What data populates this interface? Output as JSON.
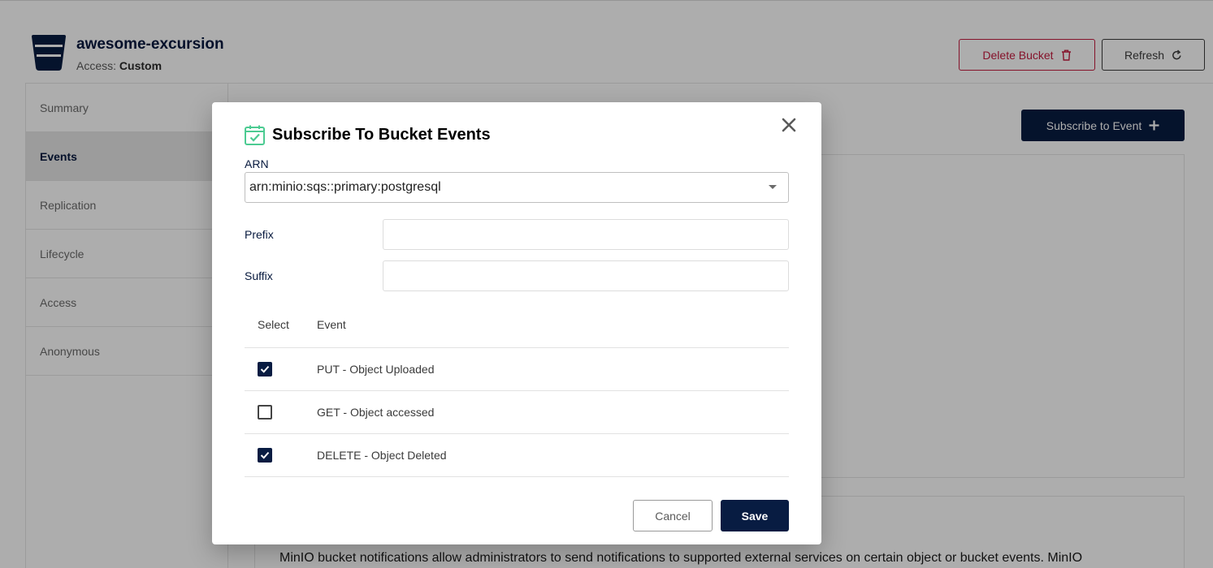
{
  "header": {
    "bucket_name": "awesome-excursion",
    "access_label": "Access:",
    "access_value": "Custom",
    "delete_button": "Delete Bucket",
    "refresh_button": "Refresh",
    "icons": {
      "bucket": "bucket-icon",
      "delete": "trash-icon",
      "refresh": "refresh-icon"
    }
  },
  "sidebar": {
    "items": [
      {
        "label": "Summary",
        "active": false
      },
      {
        "label": "Events",
        "active": true
      },
      {
        "label": "Replication",
        "active": false
      },
      {
        "label": "Lifecycle",
        "active": false
      },
      {
        "label": "Access",
        "active": false
      },
      {
        "label": "Anonymous",
        "active": false
      }
    ]
  },
  "main": {
    "subscribe_button": "Subscribe to Event",
    "help_text": "MinIO bucket notifications allow administrators to send notifications to supported external services on certain object or bucket events. MinIO"
  },
  "modal": {
    "title": "Subscribe To Bucket Events",
    "title_icon": "calendar-check-icon",
    "arn_label": "ARN",
    "arn_value": "arn:minio:sqs::primary:postgresql",
    "prefix_label": "Prefix",
    "prefix_value": "",
    "suffix_label": "Suffix",
    "suffix_value": "",
    "table": {
      "col_select": "Select",
      "col_event": "Event",
      "rows": [
        {
          "label": "PUT - Object Uploaded",
          "checked": true
        },
        {
          "label": "GET - Object accessed",
          "checked": false
        },
        {
          "label": "DELETE - Object Deleted",
          "checked": true
        }
      ]
    },
    "cancel_button": "Cancel",
    "save_button": "Save"
  },
  "colors": {
    "primary": "#081c42",
    "danger": "#c51b3f",
    "accent_icon": "#4ccb92"
  }
}
